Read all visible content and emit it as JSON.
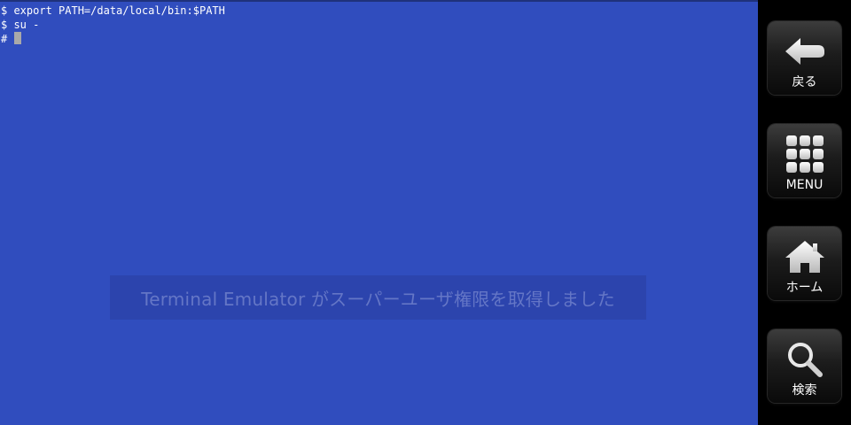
{
  "terminal": {
    "lines": [
      "$ export PATH=/data/local/bin:$PATH",
      "$ su -",
      "#"
    ],
    "background": "#304dbe",
    "text_color": "#ffffff"
  },
  "toast": {
    "message": "Terminal Emulator がスーパーユーザ権限を取得しました"
  },
  "sidebar": {
    "back": {
      "label": "戻る",
      "icon": "back-arrow-icon"
    },
    "menu": {
      "label": "MENU",
      "icon": "menu-grid-icon"
    },
    "home": {
      "label": "ホーム",
      "icon": "home-icon"
    },
    "search": {
      "label": "検索",
      "icon": "search-icon"
    }
  }
}
